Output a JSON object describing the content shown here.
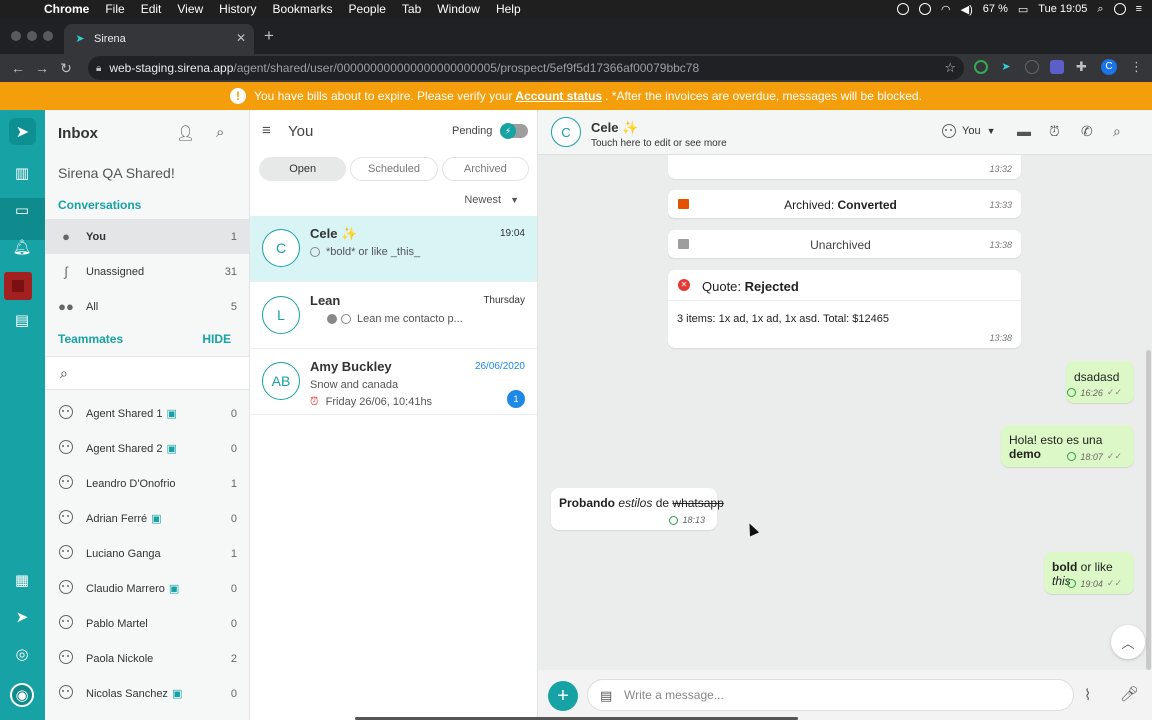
{
  "menubar": {
    "app": "Chrome",
    "items": [
      "File",
      "Edit",
      "View",
      "History",
      "Bookmarks",
      "People",
      "Tab",
      "Window",
      "Help"
    ],
    "battery": "67 %",
    "clock": "Tue 19:05"
  },
  "browser": {
    "tab_title": "Sirena",
    "url_host": "web-staging.sirena.app",
    "url_path": "/agent/shared/user/000000000000000000000005/prospect/5ef9f5d17366af00079bbc78",
    "profile_initial": "C"
  },
  "banner": {
    "text_before": "You have bills about to expire. Please verify your",
    "link": "Account status",
    "text_after": ". *After the invoices are overdue, messages will be blocked."
  },
  "inbox": {
    "title": "Inbox",
    "org": "Sirena QA Shared!",
    "conversations_label": "Conversations",
    "folders": [
      {
        "label": "You",
        "count": "1"
      },
      {
        "label": "Unassigned",
        "count": "31"
      },
      {
        "label": "All",
        "count": "5"
      }
    ],
    "teammates_label": "Teammates",
    "hide_label": "HIDE",
    "teammates": [
      {
        "name": "Agent Shared 1",
        "count": "0"
      },
      {
        "name": "Agent Shared 2",
        "count": "0"
      },
      {
        "name": "Leandro D'Onofrio",
        "count": "1"
      },
      {
        "name": "Adrian Ferré",
        "count": "0"
      },
      {
        "name": "Luciano Ganga",
        "count": "1"
      },
      {
        "name": "Claudio Marrero",
        "count": "0"
      },
      {
        "name": "Pablo Martel",
        "count": "0"
      },
      {
        "name": "Paola Nickole",
        "count": "2"
      },
      {
        "name": "Nicolas Sanchez",
        "count": "0"
      }
    ]
  },
  "convlist": {
    "title": "You",
    "pending_label": "Pending",
    "tabs": [
      "Open",
      "Scheduled",
      "Archived"
    ],
    "sort": "Newest",
    "items": [
      {
        "initials": "C",
        "name": "Cele ✨",
        "time": "19:04",
        "preview": "*bold* or like _this_"
      },
      {
        "initials": "L",
        "name": "Lean",
        "time": "Thursday",
        "preview": "Lean me contacto p..."
      },
      {
        "initials": "AB",
        "name": "Amy Buckley",
        "time": "26/06/2020",
        "preview": "Snow and canada",
        "reminder": "Friday 26/06, 10:41hs",
        "unread": "1"
      }
    ]
  },
  "chat": {
    "contact_initial": "C",
    "contact_name": "Cele ✨",
    "contact_sub": "Touch here to edit or see more",
    "assignee": "You",
    "events": [
      {
        "time": "13:32"
      },
      {
        "prefix": "Archived:",
        "status": "Converted",
        "time": "13:33"
      },
      {
        "label": "Unarchived",
        "time": "13:38"
      }
    ],
    "quote": {
      "prefix": "Quote:",
      "status": "Rejected",
      "items_label": "3 items:",
      "items_text": "1x ad, 1x ad, 1x asd. Total: $12465",
      "time": "13:38"
    },
    "messages": [
      {
        "text": "dsadasd",
        "time": "16:26"
      },
      {
        "text_a": "Hola! esto es una",
        "text_b": "demo",
        "time": "18:07"
      },
      {
        "text_a": "Probando",
        "text_b": "estilos",
        "text_c": "de",
        "text_d": "whatsapp",
        "time": "18:13"
      },
      {
        "text_a": "bold",
        "text_b": "or like",
        "text_c": "this",
        "time": "19:04"
      }
    ],
    "composer_placeholder": "Write a message..."
  }
}
